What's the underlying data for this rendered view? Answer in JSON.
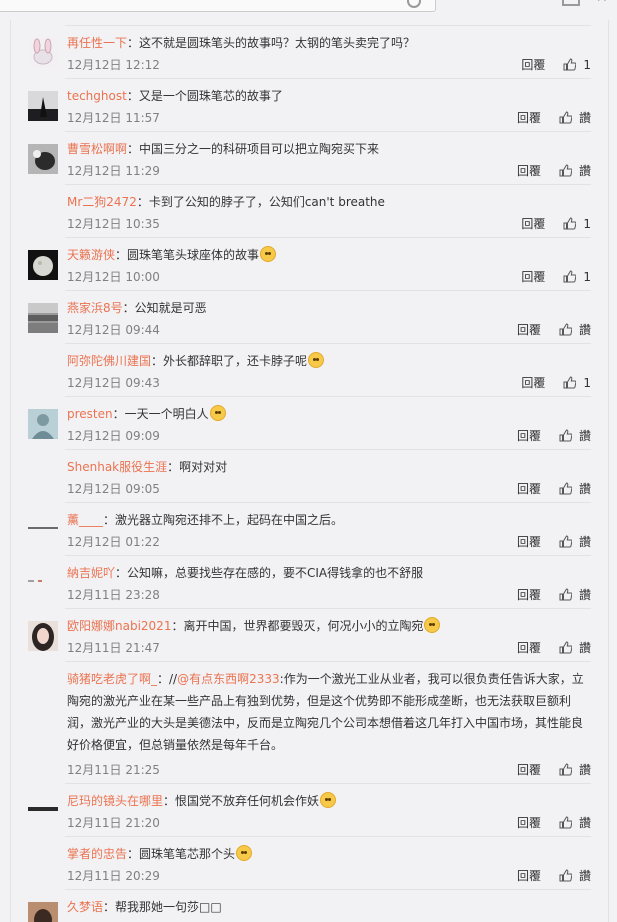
{
  "actions": {
    "reply_label": "回覆",
    "like_label": "讚"
  },
  "comments": [
    {
      "user": "再任性一下",
      "text": "：这不就是圆珠笔头的故事吗？太钢的笔头卖完了吗？",
      "time": "12月12日 12:12",
      "likes": "1",
      "avatar": "pink-rabbit-avatar"
    },
    {
      "user": "techghost",
      "text": "：又是一个圆珠笔芯的故事了",
      "time": "12月12日 11:57",
      "likes": "讚",
      "avatar": "dark-figure-avatar"
    },
    {
      "user": "曹雪松啊啊",
      "text": "：中国三分之一的科研项目可以把立陶宛买下来",
      "time": "12月12日 11:29",
      "likes": "讚",
      "avatar": "cat-avatar"
    },
    {
      "user": "Mr二狗2472",
      "text": "：卡到了公知的脖子了，公知们can't breathe",
      "time": "12月12日 10:35",
      "likes": "1",
      "avatar": ""
    },
    {
      "user": "天籁游侠",
      "text": "：圆珠笔笔头球座体的故事",
      "time": "12月12日 10:00",
      "likes": "1",
      "avatar": "moon-avatar",
      "emoji": "grin-emoji"
    },
    {
      "user": "燕家浜8号",
      "text": "：公知就是可恶",
      "time": "12月12日 09:44",
      "likes": "讚",
      "avatar": "landscape-avatar"
    },
    {
      "user": "阿弥陀佛川建国",
      "text": "：外长都辞职了，还卡脖子呢",
      "time": "12月12日 09:43",
      "likes": "1",
      "avatar": "",
      "emoji": "laugh-cry-emoji"
    },
    {
      "user": "presten",
      "text": "：一天一个明白人",
      "time": "12月12日 09:09",
      "likes": "讚",
      "avatar": "girl-avatar",
      "emoji": "surprised-emoji"
    },
    {
      "user": "Shenhak服役生涯",
      "text": "：啊对对对",
      "time": "12月12日 09:05",
      "likes": "讚",
      "avatar": ""
    },
    {
      "user": "薰____",
      "text": "：激光器立陶宛还排不上，起码在中国之后。",
      "time": "12月12日 01:22",
      "likes": "讚",
      "avatar": "line-avatar"
    },
    {
      "user": "納吉妮吖",
      "text": "：公知嘛，总要找些存在感的，要不CIA得钱拿的也不舒服",
      "time": "12月11日 23:28",
      "likes": "讚",
      "avatar": "tiny-avatar"
    },
    {
      "user": "欧阳娜娜nabi2021",
      "text": "：离开中国，世界都要毁灭，何况小小的立陶宛",
      "time": "12月11日 21:47",
      "likes": "讚",
      "avatar": "woman-avatar",
      "emoji": "laugh-cry-emoji"
    },
    {
      "user": "骑猪吃老虎了啊_",
      "mention": "@有点东西啊2333",
      "text_prefix": "：//",
      "text": ":作为一个激光工业从业者，我可以很负责任告诉大家，立陶宛的激光产业在某一些产品上有独到优势，但是这个优势即不能形成垄断，也无法获取巨额利润，激光产业的大头是美德法中，反而是立陶宛几个公司本想借着这几年打入中国市场，其性能良好价格便宜，但总销量依然是每年千台。",
      "time": "12月11日 21:25",
      "likes": "讚",
      "avatar": ""
    },
    {
      "user": "尼玛的镜头在哪里",
      "text": "：恨国党不放弃任何机会作妖",
      "time": "12月11日 21:20",
      "likes": "讚",
      "avatar": "lens-avatar",
      "emoji": "smirk-emoji"
    },
    {
      "user": "掌者的忠告",
      "text": "：圆珠笔笔芯那个头",
      "time": "12月11日 20:29",
      "likes": "讚",
      "avatar": "",
      "emoji": "scared-emoji"
    },
    {
      "user": "久梦语",
      "text": "：帮我那她一句莎□□",
      "time": "",
      "likes": "",
      "avatar": "brown-avatar"
    }
  ]
}
